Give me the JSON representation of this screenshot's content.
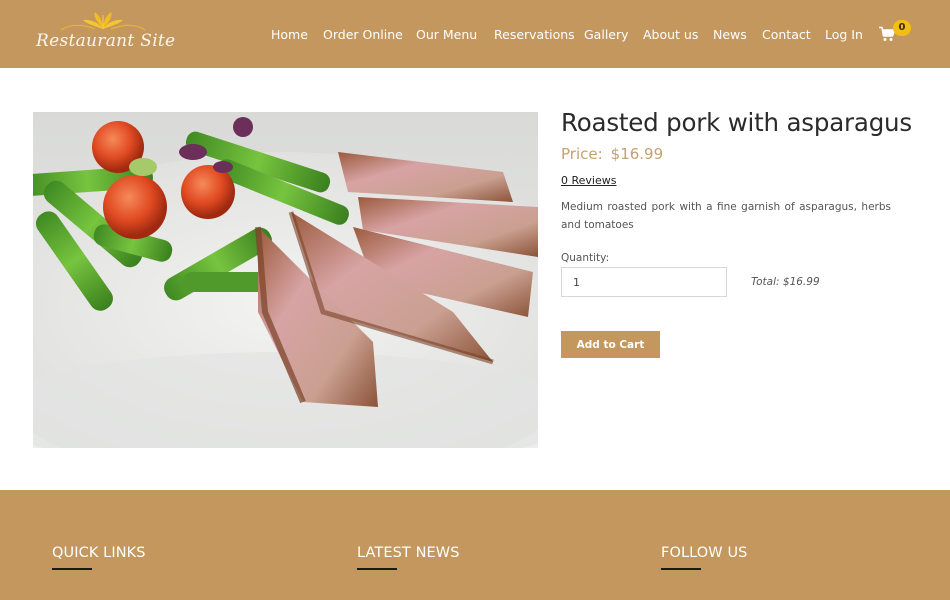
{
  "header": {
    "logo_text": "Restaurant Site",
    "brand_color": "#c4975e",
    "nav": [
      {
        "label": "Home"
      },
      {
        "label": "Order Online"
      },
      {
        "label": "Our Menu"
      },
      {
        "label": "Reservations"
      },
      {
        "label": "Gallery"
      },
      {
        "label": "About us"
      },
      {
        "label": "News"
      },
      {
        "label": "Contact"
      },
      {
        "label": "Log In"
      }
    ],
    "cart": {
      "icon": "shopping-cart-icon",
      "count": "0",
      "badge_color": "#f3bd17"
    }
  },
  "product": {
    "image_alt": "Sliced roasted pork with asparagus and cherry tomatoes on a white plate",
    "title": "Roasted pork with asparagus",
    "price_label": "Price:",
    "price_value": "$16.99",
    "reviews_link": "0 Reviews",
    "description": "Medium roasted pork with a fine garnish of asparagus, herbs and tomatoes",
    "quantity_label": "Quantity:",
    "quantity_value": "1",
    "total": "Total: $16.99",
    "add_to_cart_label": "Add to Cart"
  },
  "footer": {
    "columns": [
      {
        "heading": "QUICK LINKS"
      },
      {
        "heading": "LATEST NEWS"
      },
      {
        "heading": "FOLLOW US"
      }
    ]
  }
}
